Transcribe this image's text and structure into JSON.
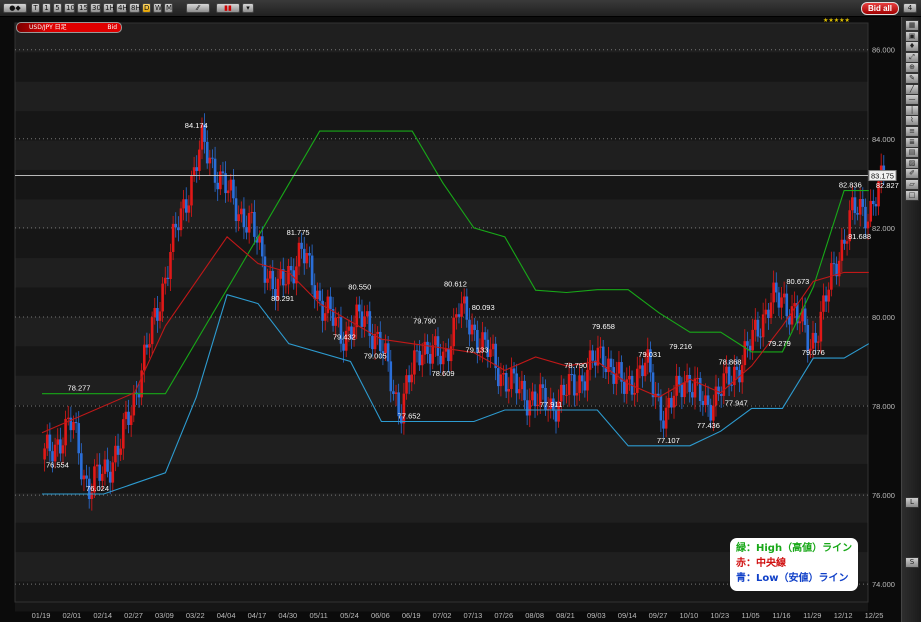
{
  "toolbar": {
    "timeframes": [
      "T",
      "1",
      "5",
      "10",
      "15",
      "30",
      "1H",
      "4H",
      "8H",
      "D",
      "W",
      "M"
    ],
    "active": "D",
    "bid_all_label": "Bid all"
  },
  "instrument": {
    "symbol": "USD/JPY 日足",
    "side": "Bid",
    "current_price_label": "83.175"
  },
  "colors": {
    "high": "#18a818",
    "mid": "#c01818",
    "low": "#2d9bd0",
    "candle_up": "#e01818",
    "candle_down": "#2a6ed8"
  },
  "legend": {
    "high": "緑：High（高値）ライン",
    "mid": "赤：中央線",
    "low": "青：Low（安値）ライン"
  },
  "chart_data": {
    "type": "line",
    "y_axis": {
      "range": [
        73.6,
        86.6
      ],
      "ticks": [
        "86.000",
        "84.000",
        "82.000",
        "80.000",
        "78.000",
        "76.000",
        "74.000"
      ],
      "side": "right"
    },
    "x_ticks": [
      "01/19",
      "02/01",
      "02/14",
      "02/27",
      "03/09",
      "03/22",
      "04/04",
      "04/17",
      "04/30",
      "05/11",
      "05/24",
      "06/06",
      "06/19",
      "07/02",
      "07/13",
      "07/26",
      "08/08",
      "08/21",
      "09/03",
      "09/14",
      "09/27",
      "10/10",
      "10/23",
      "11/05",
      "11/16",
      "11/29",
      "12/12",
      "12/25"
    ],
    "series": [
      {
        "key": "high",
        "points": [
          [
            0,
            78.277
          ],
          [
            4,
            78.277
          ],
          [
            7,
            81.8
          ],
          [
            9,
            84.174
          ],
          [
            11,
            84.174
          ],
          [
            12,
            84.174
          ],
          [
            13,
            83.0
          ],
          [
            14,
            82.0
          ],
          [
            15,
            81.8
          ],
          [
            16,
            80.6
          ],
          [
            17,
            80.55
          ],
          [
            18,
            80.612
          ],
          [
            19,
            80.612
          ],
          [
            20,
            80.093
          ],
          [
            21,
            79.658
          ],
          [
            22,
            79.658
          ],
          [
            23,
            79.216
          ],
          [
            24,
            79.216
          ],
          [
            25,
            80.673
          ],
          [
            26,
            82.836
          ],
          [
            26.8,
            82.836
          ]
        ]
      },
      {
        "key": "mid",
        "points": [
          [
            0,
            77.4
          ],
          [
            3,
            78.3
          ],
          [
            4,
            79.8
          ],
          [
            6,
            81.8
          ],
          [
            7,
            81.2
          ],
          [
            8,
            81.0
          ],
          [
            9,
            80.3
          ],
          [
            10,
            79.9
          ],
          [
            11,
            79.5
          ],
          [
            12,
            79.4
          ],
          [
            13,
            79.3
          ],
          [
            14,
            79.2
          ],
          [
            15,
            78.8
          ],
          [
            16,
            79.1
          ],
          [
            17,
            78.9
          ],
          [
            18,
            79.0
          ],
          [
            19,
            78.5
          ],
          [
            20,
            78.2
          ],
          [
            21,
            78.6
          ],
          [
            22,
            78.3
          ],
          [
            23,
            78.9
          ],
          [
            24,
            79.8
          ],
          [
            25,
            80.8
          ],
          [
            26,
            81.0
          ],
          [
            26.8,
            81.0
          ]
        ]
      },
      {
        "key": "low",
        "points": [
          [
            0,
            76.024
          ],
          [
            2,
            76.024
          ],
          [
            4,
            76.5
          ],
          [
            5,
            78.2
          ],
          [
            6,
            80.5
          ],
          [
            7,
            80.3
          ],
          [
            8,
            79.4
          ],
          [
            10,
            79.0
          ],
          [
            11,
            77.652
          ],
          [
            12,
            77.652
          ],
          [
            14,
            77.652
          ],
          [
            15,
            77.911
          ],
          [
            17,
            77.911
          ],
          [
            18,
            77.911
          ],
          [
            19,
            77.107
          ],
          [
            20,
            77.107
          ],
          [
            21,
            77.107
          ],
          [
            22,
            77.436
          ],
          [
            23,
            77.947
          ],
          [
            24,
            77.947
          ],
          [
            25,
            79.076
          ],
          [
            26,
            79.076
          ],
          [
            26.8,
            79.4
          ]
        ]
      }
    ],
    "annotations": [
      {
        "label": "78.277",
        "x": 1.2,
        "y": 78.277
      },
      {
        "label": "76.554",
        "x": 0.5,
        "y": 76.554
      },
      {
        "label": "76.024",
        "x": 1.8,
        "y": 76.024
      },
      {
        "label": "84.174",
        "x": 5.0,
        "y": 84.174
      },
      {
        "label": "81.775",
        "x": 8.3,
        "y": 81.775
      },
      {
        "label": "80.291",
        "x": 7.8,
        "y": 80.291
      },
      {
        "label": "80.550",
        "x": 10.3,
        "y": 80.55
      },
      {
        "label": "79.432",
        "x": 9.8,
        "y": 79.432
      },
      {
        "label": "79.005",
        "x": 10.8,
        "y": 79.005
      },
      {
        "label": "79.790",
        "x": 12.4,
        "y": 79.79
      },
      {
        "label": "77.652",
        "x": 11.9,
        "y": 77.652
      },
      {
        "label": "80.612",
        "x": 13.4,
        "y": 80.612
      },
      {
        "label": "78.609",
        "x": 13.0,
        "y": 78.609
      },
      {
        "label": "80.093",
        "x": 14.3,
        "y": 80.093
      },
      {
        "label": "79.133",
        "x": 14.1,
        "y": 79.133
      },
      {
        "label": "77.911",
        "x": 16.5,
        "y": 77.911
      },
      {
        "label": "78.790",
        "x": 17.3,
        "y": 78.79
      },
      {
        "label": "79.658",
        "x": 18.2,
        "y": 79.658
      },
      {
        "label": "79.031",
        "x": 19.7,
        "y": 79.031
      },
      {
        "label": "79.216",
        "x": 20.7,
        "y": 79.216
      },
      {
        "label": "77.107",
        "x": 20.3,
        "y": 77.107
      },
      {
        "label": "78.868",
        "x": 22.3,
        "y": 78.868
      },
      {
        "label": "77.436",
        "x": 21.6,
        "y": 77.436
      },
      {
        "label": "77.947",
        "x": 22.5,
        "y": 77.947
      },
      {
        "label": "80.673",
        "x": 24.5,
        "y": 80.673
      },
      {
        "label": "79.279",
        "x": 23.9,
        "y": 79.279
      },
      {
        "label": "79.076",
        "x": 25.0,
        "y": 79.076
      },
      {
        "label": "82.836",
        "x": 26.2,
        "y": 82.836
      },
      {
        "label": "82.827",
        "x": 27.4,
        "y": 82.827
      },
      {
        "label": "81.688",
        "x": 26.5,
        "y": 81.688
      }
    ]
  }
}
